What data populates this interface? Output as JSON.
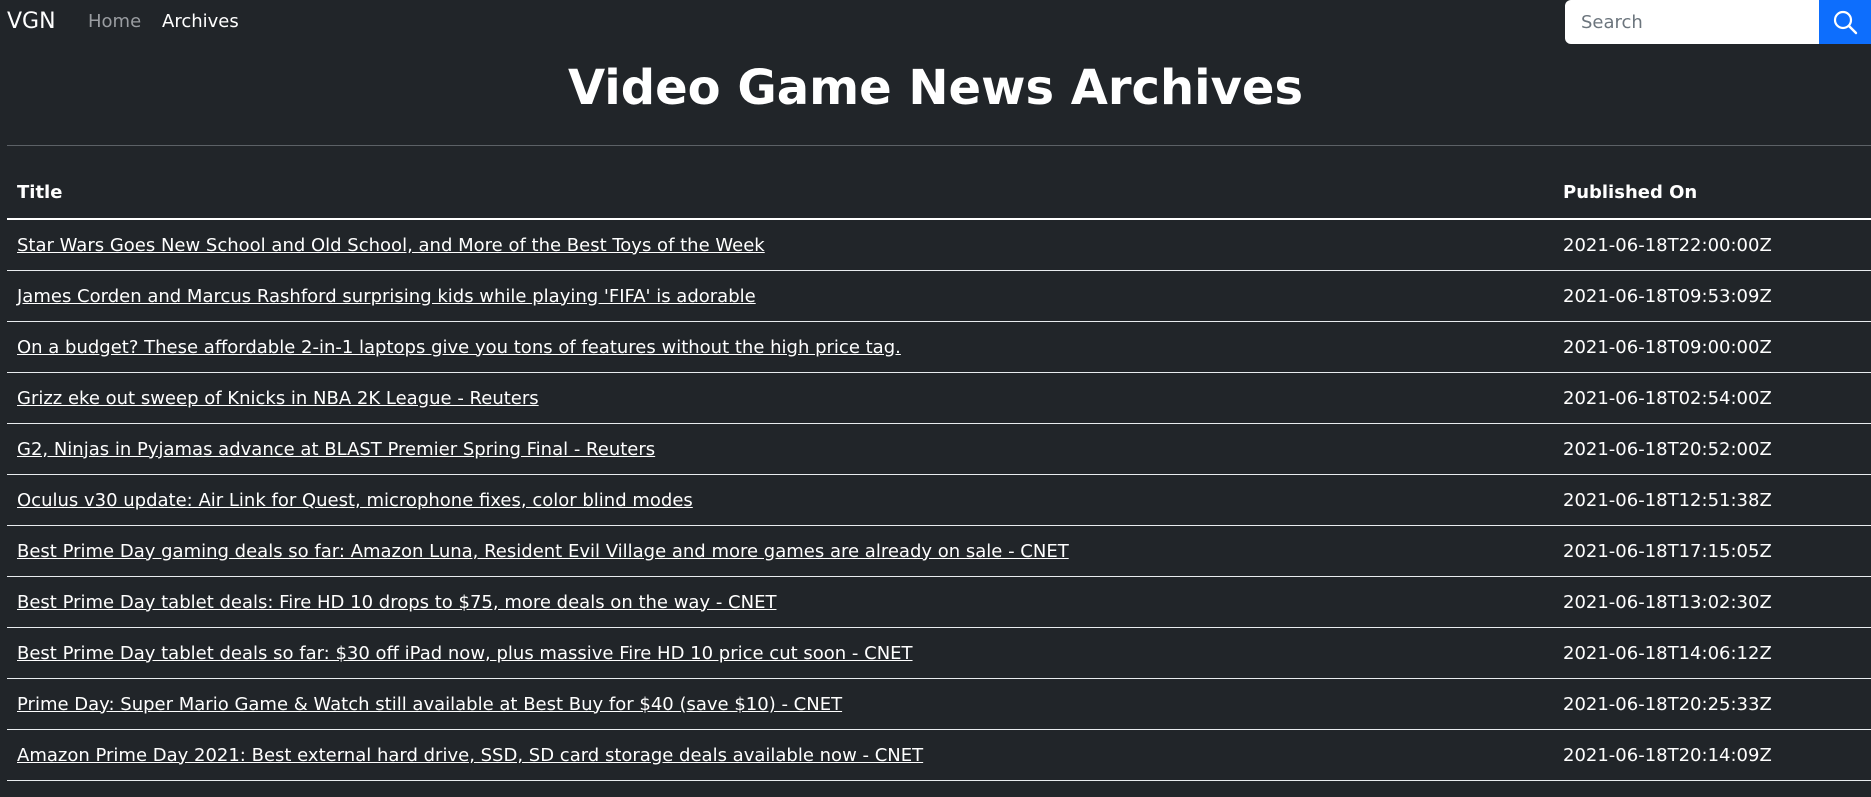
{
  "nav": {
    "brand": "VGN",
    "links": [
      {
        "label": "Home",
        "active": false
      },
      {
        "label": "Archives",
        "active": true
      }
    ],
    "search": {
      "placeholder": "Search",
      "value": "",
      "button_icon": "search-icon"
    }
  },
  "page": {
    "title": "Video Game News Archives"
  },
  "table": {
    "headers": [
      "Title",
      "Published On"
    ],
    "rows": [
      {
        "title": "Star Wars Goes New School and Old School, and More of the Best Toys of the Week",
        "published": "2021-06-18T22:00:00Z"
      },
      {
        "title": "James Corden and Marcus Rashford surprising kids while playing 'FIFA' is adorable",
        "published": "2021-06-18T09:53:09Z"
      },
      {
        "title": "On a budget? These affordable 2-in-1 laptops give you tons of features without the high price tag.",
        "published": "2021-06-18T09:00:00Z"
      },
      {
        "title": "Grizz eke out sweep of Knicks in NBA 2K League - Reuters",
        "published": "2021-06-18T02:54:00Z"
      },
      {
        "title": "G2, Ninjas in Pyjamas advance at BLAST Premier Spring Final - Reuters",
        "published": "2021-06-18T20:52:00Z"
      },
      {
        "title": "Oculus v30 update: Air Link for Quest, microphone fixes, color blind modes",
        "published": "2021-06-18T12:51:38Z"
      },
      {
        "title": "Best Prime Day gaming deals so far: Amazon Luna, Resident Evil Village and more games are already on sale - CNET",
        "published": "2021-06-18T17:15:05Z"
      },
      {
        "title": "Best Prime Day tablet deals: Fire HD 10 drops to $75, more deals on the way - CNET",
        "published": "2021-06-18T13:02:30Z"
      },
      {
        "title": "Best Prime Day tablet deals so far: $30 off iPad now, plus massive Fire HD 10 price cut soon - CNET",
        "published": "2021-06-18T14:06:12Z"
      },
      {
        "title": "Prime Day: Super Mario Game & Watch still available at Best Buy for $40 (save $10) - CNET",
        "published": "2021-06-18T20:25:33Z"
      },
      {
        "title": "Amazon Prime Day 2021: Best external hard drive, SSD, SD card storage deals available now - CNET",
        "published": "2021-06-18T20:14:09Z"
      }
    ]
  },
  "colors": {
    "background": "#212529",
    "text": "#ffffff",
    "nav_inactive": "#9a9da1",
    "search_button": "#0d6efd"
  }
}
